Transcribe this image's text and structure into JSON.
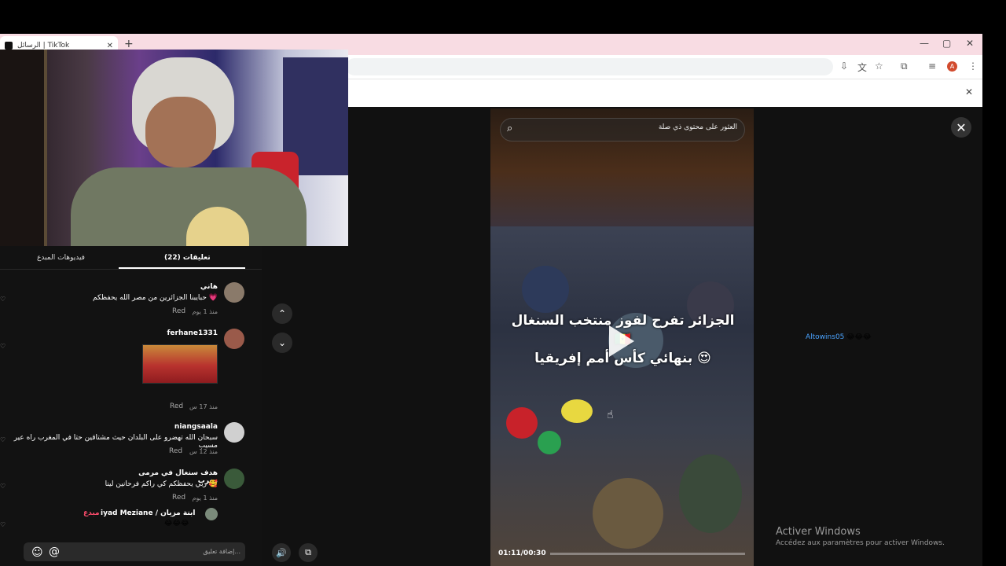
{
  "browser": {
    "tab_title": "الرسائل | TikTok",
    "tab_close": "✕",
    "new_tab": "+",
    "win_min": "—",
    "win_max": "▢",
    "win_close": "✕",
    "profile_initial": "A",
    "infobar_close": "✕"
  },
  "comments_panel": {
    "tabs": [
      "فيديوهات المبدع",
      "(22) تعليقات"
    ],
    "comments": [
      {
        "user": "هاني",
        "text": "حبايبنا الجزائرين من مصر الله يحفظكم 💗",
        "time": "منذ 1 يوم",
        "reply": "Red"
      },
      {
        "user": "ferhane1331",
        "text": "",
        "time": "منذ 17 س",
        "reply": "Red"
      },
      {
        "user": "niangsaala",
        "text": "سبحان الله تهضرو على البلدان حيث مشتاقين حتا في المغرب راه عير مسيب",
        "time": "منذ 12 س",
        "reply": "Red"
      },
      {
        "user": "هدف سنغال في مرمى مغرب",
        "text": "ربي يحفظكم كي راكم فرحانين لينا 🥰",
        "time": "منذ 1 يوم",
        "reply": "Red"
      }
    ],
    "last_comment": {
      "prefix": "مبدع",
      "user": "iyad Meziane / ابنة مزيان",
      "emoji": "💖 🍇",
      "emoji_line": "😂😂😂"
    },
    "input_placeholder": "إضافة تعليق...",
    "emoji_btn": "☺",
    "at_btn": "@"
  },
  "nav": {
    "up": "⌃",
    "down": "⌄"
  },
  "video": {
    "search_text": "العثور على محتوى ذي صلة",
    "search_icon": "⌕",
    "caption_line1": "الجزائر تفرح لفوز منتخب السنغال 🇸🇳",
    "caption_line2": "بنهائي كأس أمم إفريقيا 😍",
    "time": "01:11/00:30",
    "close": "✕",
    "volume": "🔊",
    "pip": "⧉"
  },
  "side_comment": {
    "user": "Altowins05",
    "text": "😂😂😂"
  },
  "watermark": {
    "title": "Activer Windows",
    "subtitle": "Accédez aux paramètres pour activer Windows."
  },
  "colors": {
    "accent": "#4aa3ff",
    "tabbar": "#f8dce3",
    "panel": "#121212"
  }
}
